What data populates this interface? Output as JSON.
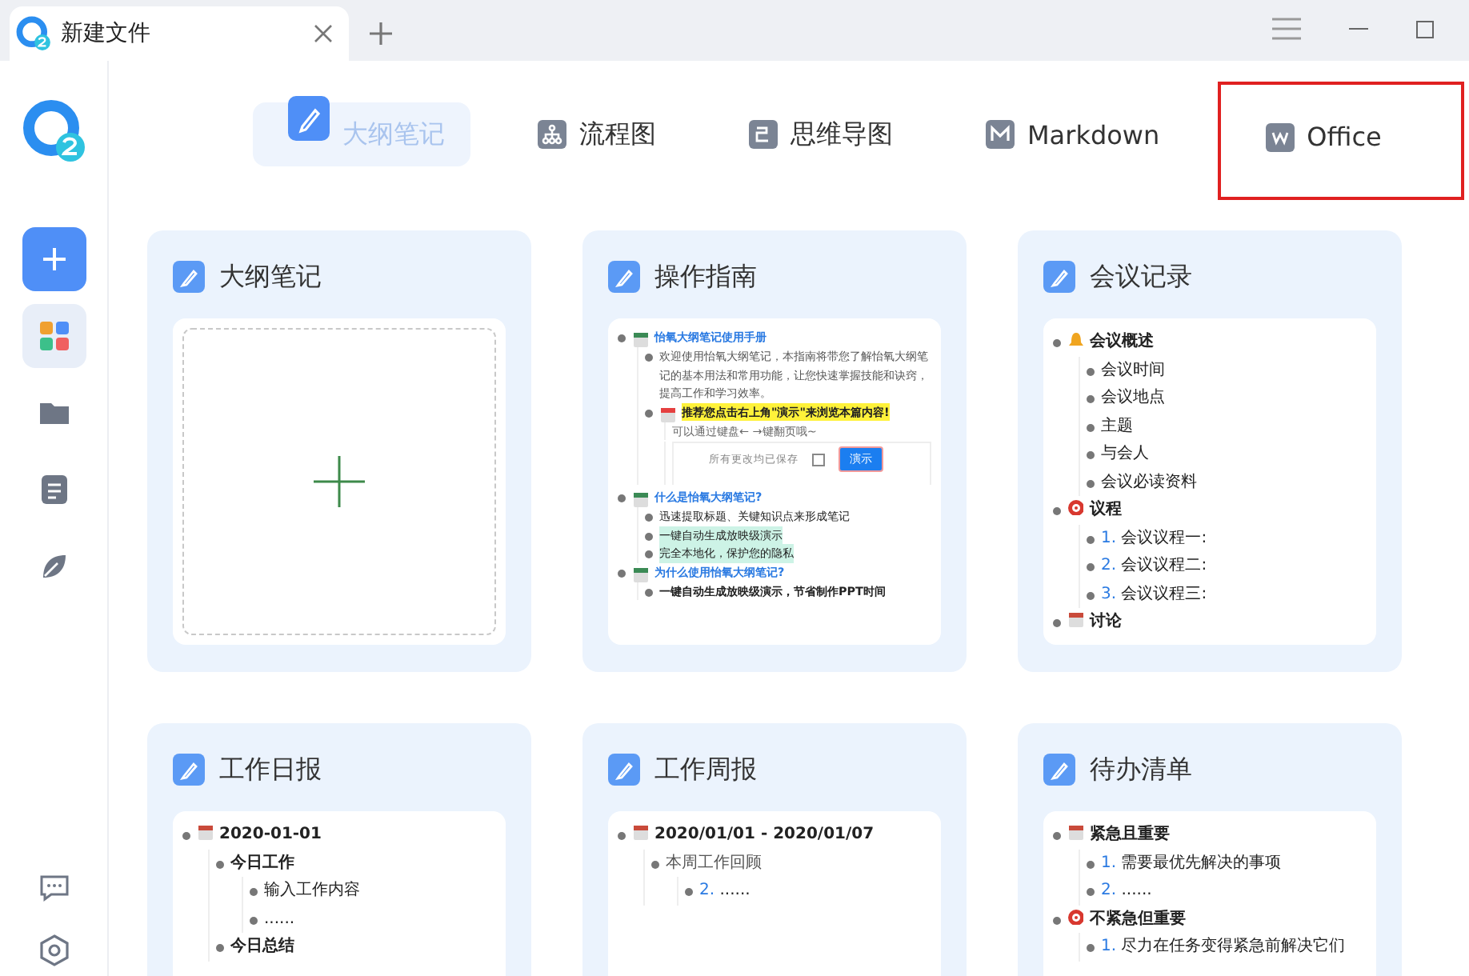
{
  "window": {
    "tab_title": "新建文件"
  },
  "sidebar": {
    "items": [
      {
        "kind": "grid",
        "selected": true
      },
      {
        "kind": "folder",
        "selected": false
      },
      {
        "kind": "doc",
        "selected": false
      },
      {
        "kind": "leaf",
        "selected": false
      }
    ]
  },
  "type_tabs": [
    {
      "label": "大纲笔记",
      "kind": "outline",
      "selected": true,
      "highlighted": false
    },
    {
      "label": "流程图",
      "kind": "flowchart",
      "selected": false,
      "highlighted": false
    },
    {
      "label": "思维导图",
      "kind": "mindmap",
      "selected": false,
      "highlighted": false
    },
    {
      "label": "Markdown",
      "kind": "markdown",
      "selected": false,
      "highlighted": false
    },
    {
      "label": "Office",
      "kind": "office",
      "selected": false,
      "highlighted": true
    }
  ],
  "templates": [
    {
      "title": "大纲笔记",
      "preview": {
        "kind": "blank"
      }
    },
    {
      "title": "操作指南",
      "preview": {
        "kind": "guide",
        "items": [
          {
            "text": "怡氧大纲笔记使用手册",
            "kind": "title",
            "children": [
              {
                "text": "欢迎使用怡氧大纲笔记，本指南将带您了解怡氧大纲笔记的基本用法和常用功能，让您快速掌握技能和诀窍，提高工作和学习效率。",
                "kind": "muted"
              },
              {
                "text": "推荐您点击右上角\"演示\"来浏览本篇内容!",
                "kind": "yellow",
                "note": "可以通过键盘← →键翻页哦~",
                "toolbar": {
                  "saved": "所有更改均已保存",
                  "button": "演示"
                }
              }
            ]
          },
          {
            "text": "什么是怡氧大纲笔记?",
            "kind": "title",
            "children": [
              {
                "text": "迅速提取标题、关键知识点来形成笔记",
                "kind": "plain"
              },
              {
                "text": "一键自动生成放映级演示",
                "kind": "green"
              },
              {
                "text": "完全本地化，保护您的隐私",
                "kind": "green"
              }
            ]
          },
          {
            "text": "为什么使用怡氧大纲笔记?",
            "kind": "title",
            "children": [
              {
                "text": "一键自动生成放映级演示，节省制作PPT时间",
                "kind": "bold"
              }
            ]
          }
        ]
      }
    },
    {
      "title": "会议记录",
      "preview": {
        "kind": "outline",
        "items": [
          {
            "text": "会议概述",
            "kind": "heading",
            "children": [
              {
                "text": "会议时间",
                "kind": "plain"
              },
              {
                "text": "会议地点",
                "kind": "plain"
              },
              {
                "text": "主题",
                "kind": "plain"
              },
              {
                "text": "与会人",
                "kind": "plain"
              },
              {
                "text": "会议必读资料",
                "kind": "plain"
              }
            ]
          },
          {
            "text": "议程",
            "kind": "heading",
            "children": [
              {
                "number": "1.",
                "text": "会议议程一:",
                "kind": "plain"
              },
              {
                "number": "2.",
                "text": "会议议程二:",
                "kind": "plain"
              },
              {
                "number": "3.",
                "text": "会议议程三:",
                "kind": "plain"
              }
            ]
          },
          {
            "text": "讨论",
            "kind": "heading"
          }
        ]
      }
    },
    {
      "title": "工作日报",
      "preview": {
        "kind": "outline",
        "items": [
          {
            "text": "2020-01-01",
            "kind": "heading",
            "children": [
              {
                "text": "今日工作",
                "kind": "bold",
                "children": [
                  {
                    "text": "输入工作内容",
                    "kind": "plain"
                  },
                  {
                    "text": "......",
                    "kind": "plain"
                  }
                ]
              },
              {
                "text": "今日总结",
                "kind": "bold"
              }
            ]
          }
        ]
      }
    },
    {
      "title": "工作周报",
      "preview": {
        "kind": "outline",
        "items": [
          {
            "text": "2020/01/01 - 2020/01/07",
            "kind": "heading",
            "children": [
              {
                "text": "本周工作回顾",
                "kind": "muted",
                "children": [
                  {
                    "number": "2.",
                    "text": "......",
                    "kind": "plain"
                  }
                ]
              }
            ]
          }
        ]
      }
    },
    {
      "title": "待办清单",
      "preview": {
        "kind": "outline",
        "items": [
          {
            "text": "紧急且重要",
            "kind": "heading",
            "children": [
              {
                "number": "1.",
                "text": "需要最优先解决的事项",
                "kind": "plain"
              },
              {
                "number": "2.",
                "text": "......",
                "kind": "plain"
              }
            ]
          },
          {
            "text": "不紧急但重要",
            "kind": "heading",
            "children": [
              {
                "number": "1.",
                "text": "尽力在任务变得紧急前解决它们",
                "kind": "plain"
              }
            ]
          }
        ]
      }
    }
  ]
}
